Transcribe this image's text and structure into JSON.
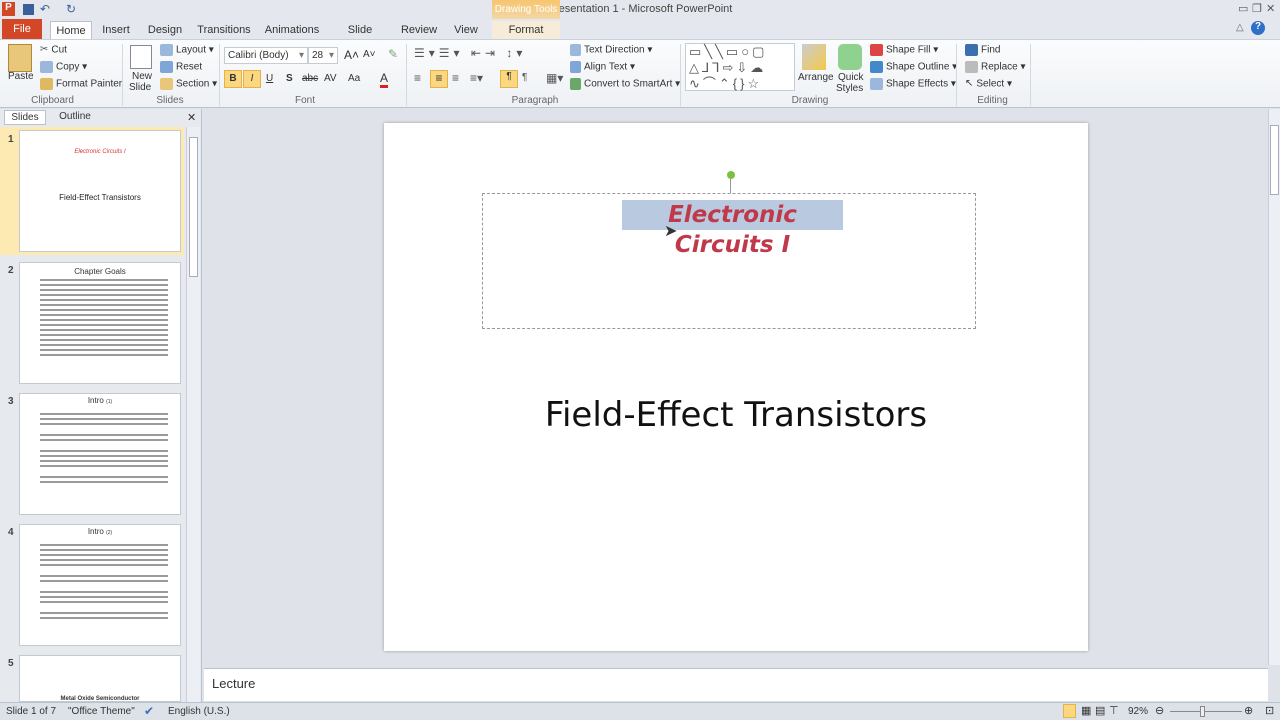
{
  "window": {
    "title": "Presentation 1  -  Microsoft PowerPoint",
    "contextual_tab_group": "Drawing Tools"
  },
  "tabs": [
    "File",
    "Home",
    "Insert",
    "Design",
    "Transitions",
    "Animations",
    "Slide Show",
    "Review",
    "View",
    "Format"
  ],
  "ribbon": {
    "clipboard": {
      "label": "Clipboard",
      "paste": "Paste",
      "cut": "Cut",
      "copy": "Copy",
      "format_painter": "Format Painter"
    },
    "slides": {
      "label": "Slides",
      "new_slide": "New",
      "new_slide2": "Slide",
      "layout": "Layout",
      "reset": "Reset",
      "section": "Section"
    },
    "font": {
      "label": "Font",
      "font_name": "Calibri (Body)",
      "font_size": "28",
      "bold": "B",
      "italic": "I",
      "underline": "U",
      "shadow": "S",
      "strike": "abc",
      "spacing": "AV",
      "case": "Aa",
      "color": "A"
    },
    "paragraph": {
      "label": "Paragraph",
      "text_direction": "Text Direction",
      "align_text": "Align Text",
      "convert_smartart": "Convert to SmartArt"
    },
    "drawing": {
      "label": "Drawing",
      "arrange": "Arrange",
      "quick_styles": "Quick",
      "quick_styles2": "Styles",
      "shape_fill": "Shape Fill",
      "shape_outline": "Shape Outline",
      "shape_effects": "Shape Effects"
    },
    "editing": {
      "label": "Editing",
      "find": "Find",
      "replace": "Replace",
      "select": "Select"
    }
  },
  "left_panel": {
    "tabs": [
      "Slides",
      "Outline"
    ],
    "thumbnails": [
      {
        "num": "1",
        "subtitle": "Electronic Circuits I",
        "title": "Field-Effect Transistors"
      },
      {
        "num": "2",
        "title": "Chapter Goals"
      },
      {
        "num": "3",
        "title": "Intro",
        "suffix": "(1)"
      },
      {
        "num": "4",
        "title": "Intro",
        "suffix": "(2)"
      },
      {
        "num": "5",
        "title": "Metal Oxide Semiconductor"
      }
    ]
  },
  "slide": {
    "subtitle": "Electronic Circuits I",
    "title": "Field-Effect Transistors",
    "subtitle_color": "#c0394b"
  },
  "notes": {
    "text": "Lecture"
  },
  "status": {
    "slide_count": "Slide 1 of 7",
    "theme": "\"Office Theme\"",
    "language": "English (U.S.)",
    "zoom": "92%",
    "zoom_fraction": 0.46
  }
}
